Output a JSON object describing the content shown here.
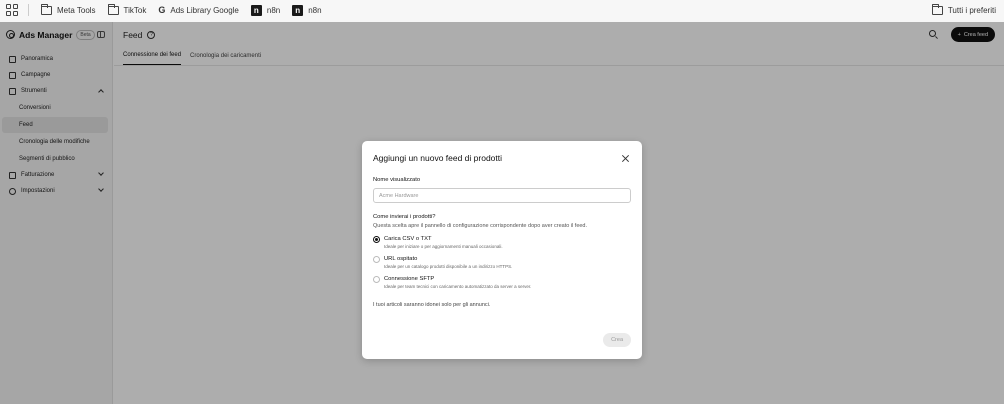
{
  "bookmarks": {
    "items": [
      {
        "label": "Meta Tools",
        "icon": "folder-icon"
      },
      {
        "label": "TikTok",
        "icon": "folder-icon"
      },
      {
        "label": "Ads Library Google",
        "icon": "google-icon",
        "glyph": "G"
      },
      {
        "label": "n8n",
        "icon": "n8n-icon",
        "glyph": "n"
      },
      {
        "label": "n8n",
        "icon": "n8n-icon",
        "glyph": "n"
      }
    ],
    "all_label": "Tutti i preferiti"
  },
  "sidebar": {
    "brand": "Ads Manager",
    "beta": "Beta",
    "items": [
      {
        "label": "Panoramica",
        "icon": "home-icon"
      },
      {
        "label": "Campagne",
        "icon": "megaphone-icon"
      },
      {
        "label": "Strumenti",
        "icon": "tools-icon"
      },
      {
        "label": "Conversioni"
      },
      {
        "label": "Feed"
      },
      {
        "label": "Cronologia delle modifiche"
      },
      {
        "label": "Segmenti di pubblico"
      },
      {
        "label": "Fatturazione",
        "icon": "billing-icon"
      },
      {
        "label": "Impostazioni",
        "icon": "gear-icon"
      }
    ]
  },
  "header": {
    "title": "Feed",
    "help_glyph": "?",
    "create_label": "Crea feed",
    "create_glyph": "+"
  },
  "tabs": [
    {
      "label": "Connessione dei feed"
    },
    {
      "label": "Cronologia dei caricamenti"
    }
  ],
  "modal": {
    "title": "Aggiungi un nuovo feed di prodotti",
    "name_label": "Nome visualizzato",
    "name_placeholder": "Acme Hardware",
    "name_value": "",
    "question": "Come invierai i prodotti?",
    "question_desc": "Questa scelta apre il pannello di configurazione corrispondente dopo aver creato il feed.",
    "options": [
      {
        "title": "Carica CSV o TXT",
        "desc": "Ideale per iniziare o per aggiornamenti manuali occasionali.",
        "selected": true
      },
      {
        "title": "URL ospitato",
        "desc": "Ideale per un catalogo prodotti disponibile a un indirizzo HTTPS.",
        "selected": false
      },
      {
        "title": "Connessione SFTP",
        "desc": "Ideale per team tecnici con caricamento automatizzato da server a server.",
        "selected": false
      }
    ],
    "footnote": "I tuoi articoli saranno idonei solo per gli annunci.",
    "confirm_label": "Crea"
  }
}
